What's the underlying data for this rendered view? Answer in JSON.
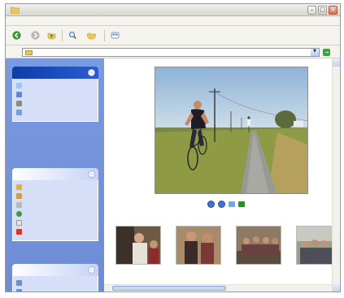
{
  "window": {
    "title": ""
  },
  "menubar": {
    "items": [
      "",
      "",
      "",
      "",
      "",
      ""
    ]
  },
  "toolbar": {
    "back_label": "",
    "search_label": "",
    "folders_label": ""
  },
  "address": {
    "label": "",
    "value": "",
    "go_label": ""
  },
  "sidebar": {
    "picture_tasks": {
      "title": "",
      "items": [
        "",
        "",
        "",
        ""
      ]
    },
    "file_tasks": {
      "title": "",
      "items": [
        "",
        "",
        "",
        "",
        "",
        ""
      ]
    },
    "details": {
      "title": "",
      "items": [
        "",
        ""
      ]
    }
  },
  "thumbnails": [
    {
      "label": ""
    },
    {
      "label": ""
    },
    {
      "label": ""
    },
    {
      "label": ""
    }
  ],
  "icons": {
    "back": "back-arrow-icon",
    "forward": "forward-arrow-icon",
    "up": "folder-up-icon",
    "search": "search-icon",
    "folders": "folders-icon",
    "views": "views-icon"
  },
  "colors": {
    "sidebar_bg": "#7a9ae0",
    "panel_link": "#215dc6",
    "special_head": "#0c3ea8"
  }
}
